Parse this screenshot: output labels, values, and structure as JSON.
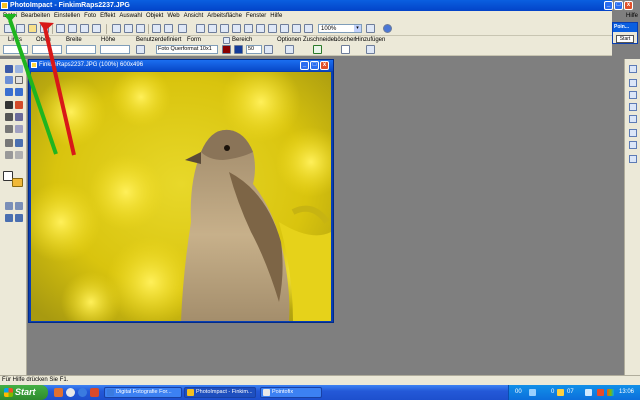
{
  "app": {
    "title": "PhotoImpact - FinkimRaps2237.JPG",
    "minimize": "_",
    "maximize": "□",
    "close": "x"
  },
  "menu": {
    "items": [
      "Datei",
      "Bearbeiten",
      "Einstellen",
      "Foto",
      "Effekt",
      "Auswahl",
      "Objekt",
      "Web",
      "Ansicht",
      "Arbeitsfläche",
      "Fenster",
      "Hilfe"
    ],
    "right_label": "Hilfe"
  },
  "toolbar": {
    "zoom_value": "100%",
    "dropdown_arrow": "▾"
  },
  "attributes": {
    "labels": {
      "links": "Links",
      "oben": "Oben",
      "breite": "Breite",
      "hoehe": "Höhe",
      "benutzerdefiniert": "Benutzerdefiniert",
      "form": "Form",
      "bereich": "Bereich",
      "optionen": "Optionen",
      "zuschneiden": "Zuschneiden",
      "loeschen": "Löschen",
      "hinzufuegen": "Hinzufügen"
    },
    "format_value": "Foto Querformat 10x1",
    "bereich_value": "50"
  },
  "pointer_panel": {
    "title": "Poin...",
    "start_label": "Start"
  },
  "document": {
    "title": "FinkimRaps2237.JPG (100%) 600x496"
  },
  "status": {
    "text": "Für Hilfe drücken Sie F1."
  },
  "taskbar": {
    "start_label": "Start",
    "tasks": [
      {
        "label": "Digital Fotografie For..."
      },
      {
        "label": "PhotoImpact - Finkim..."
      },
      {
        "label": "Pointofix"
      }
    ],
    "tray": {
      "items": [
        "00",
        "0",
        "0",
        "00",
        "07"
      ],
      "clock": "13:06"
    }
  },
  "colors": {
    "title_blue": "#0343c8",
    "taskbar_blue": "#2459d8",
    "start_green": "#2e8a2e",
    "workspace_gray": "#7f7f7f",
    "canvas_yellow": "#e6d20c",
    "annotation_green": "#1fb51f",
    "annotation_red": "#d81818"
  }
}
